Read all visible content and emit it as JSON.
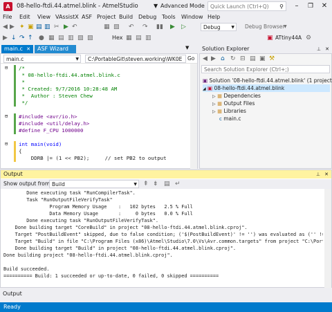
{
  "title_bar": {
    "app_icon": "A",
    "title": "08-hello-ftdi.44.atmel.blink - AtmelStudio",
    "advanced_mode": "Advanced Mode",
    "quick_launch_placeholder": "Quick Launch (Ctrl+Q)",
    "search_icon": "search-icon",
    "minimize": "–",
    "restore": "❐",
    "close": "✕"
  },
  "menu": {
    "items": [
      "File",
      "Edit",
      "View",
      "VAssistX",
      "ASF",
      "Project",
      "Build",
      "Debug",
      "Tools",
      "Window",
      "Help"
    ]
  },
  "toolbar": {
    "hex_label": "Hex",
    "configuration": "Debug",
    "debug_browser": "Debug Browser",
    "device": "ATtiny44A"
  },
  "editor": {
    "tabs": [
      {
        "label": "main.c",
        "active": true
      },
      {
        "label": "ASF Wizard",
        "active": false
      }
    ],
    "nav_left": "main.c",
    "nav_path": "C:\\PortableGit\\steven.working\\WK0E",
    "nav_go": "Go",
    "lines": [
      {
        "text": "/*",
        "cls": "cm"
      },
      {
        "text": " * 08-hello-ftdi.44.atmel.blink.c",
        "cls": "cm"
      },
      {
        "text": " *",
        "cls": "cm"
      },
      {
        "text": " * Created: 9/7/2016 10:28:48 AM",
        "cls": "cm"
      },
      {
        "text": " *  Author : Steven Chew",
        "cls": "cm"
      },
      {
        "text": " */",
        "cls": "cm"
      },
      {
        "text": "",
        "cls": ""
      },
      {
        "text": "#include <avr/io.h>",
        "cls": "pp"
      },
      {
        "text": "#include <util/delay.h>",
        "cls": "pp"
      },
      {
        "text": "#define F_CPU 1000000",
        "cls": "pp"
      },
      {
        "text": "",
        "cls": ""
      },
      {
        "text": "int main(void)",
        "cls": "kw"
      },
      {
        "text": "{",
        "cls": ""
      },
      {
        "text": "    DDRB |= (1 << PB2);     // set PB2 to output",
        "cls": ""
      }
    ]
  },
  "solution_explorer": {
    "title": "Solution Explorer",
    "search_placeholder": "Search Solution Explorer (Ctrl+;)",
    "tree": [
      {
        "label": "Solution '08-hello-ftdi.44.atmel.blink' (1 project)",
        "indent": 0,
        "icon": "solution-icon",
        "selected": false
      },
      {
        "label": "08-hello-ftdi.44.atmel.blink",
        "indent": 1,
        "icon": "project-icon",
        "selected": true
      },
      {
        "label": "Dependencies",
        "indent": 2,
        "icon": "folder-icon",
        "selected": false
      },
      {
        "label": "Output Files",
        "indent": 2,
        "icon": "folder-icon",
        "selected": false
      },
      {
        "label": "Libraries",
        "indent": 2,
        "icon": "folder-icon",
        "selected": false
      },
      {
        "label": "main.c",
        "indent": 2,
        "icon": "c-file-icon",
        "selected": false
      }
    ]
  },
  "output": {
    "title": "Output",
    "show_from_label": "Show output from:",
    "show_from_value": "Build",
    "lines": [
      "        Done executing task \"RunCompilerTask\".",
      "        Task \"RunOutputFileVerifyTask\"",
      "                Program Memory Usage    :   102 bytes   2.5 % Full",
      "                Data Memory Usage       :     0 bytes   0.0 % Full",
      "        Done executing task \"RunOutputFileVerifyTask\".",
      "    Done building target \"CoreBuild\" in project \"08-hello-ftdi.44.atmel.blink.cproj\".",
      "    Target \"PostBuildEvent\" skipped, due to false condition; ('$(PostBuildEvent)' != '') was evaluated as ('' != '').",
      "    Target \"Build\" in file \"C:\\Program Files (x86)\\Atmel\\Studio\\7.0\\Vs\\Avr.common.targets\" from project \"C:\\PortableGit\\stev",
      "    Done building target \"Build\" in project \"08-hello-ftdi.44.atmel.blink.cproj\".",
      "Done building project \"08-hello-ftdi.44.atmel.blink.cproj\".",
      "",
      "Build succeeded.",
      "========== Build: 1 succeeded or up-to-date, 0 failed, 0 skipped =========="
    ]
  },
  "bottom_tab": "Output",
  "status": "Ready",
  "colors": {
    "accent": "#007acc",
    "output_title_bg": "#fff3a0",
    "app_icon": "#c8102e"
  }
}
